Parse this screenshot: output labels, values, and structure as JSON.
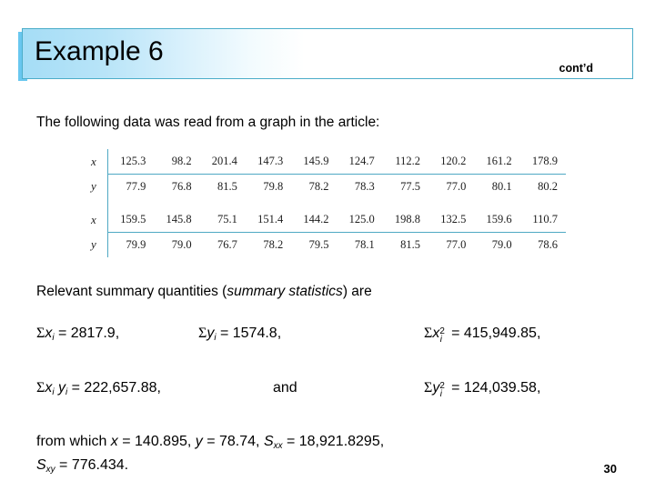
{
  "header": {
    "title": "Example 6",
    "contd_label": "cont’d",
    "accent_color": "#69c7ef",
    "border_color": "#4badc9",
    "gradient_start": "#a5ddf6",
    "gradient_end": "#ffffff"
  },
  "body": {
    "intro_text": "The following data was read from a graph in the article:",
    "summary_prefix": "Relevant summary quantities (",
    "summary_emphasis": "summary statistics",
    "summary_suffix": ") are"
  },
  "table": {
    "rule_color": "#4fa9c4",
    "rows": [
      {
        "label": "x",
        "values": [
          "125.3",
          "98.2",
          "201.4",
          "147.3",
          "145.9",
          "124.7",
          "112.2",
          "120.2",
          "161.2",
          "178.9"
        ]
      },
      {
        "label": "y",
        "values": [
          "77.9",
          "76.8",
          "81.5",
          "79.8",
          "78.2",
          "78.3",
          "77.5",
          "77.0",
          "80.1",
          "80.2"
        ]
      },
      {
        "label": "x",
        "values": [
          "159.5",
          "145.8",
          "75.1",
          "151.4",
          "144.2",
          "125.0",
          "198.8",
          "132.5",
          "159.6",
          "110.7"
        ]
      },
      {
        "label": "y",
        "values": [
          "79.9",
          "79.0",
          "76.7",
          "78.2",
          "79.5",
          "78.1",
          "81.5",
          "77.0",
          "79.0",
          "78.6"
        ]
      }
    ]
  },
  "summary_quantities": {
    "sum_x": {
      "sigma": "Σ",
      "var": "x",
      "sub": "i",
      "equals": "= 2817.9,"
    },
    "sum_y": {
      "sigma": "Σ",
      "var": "y",
      "sub": "i",
      "equals": "= 1574.8,"
    },
    "sum_x2": {
      "sigma": "Σ",
      "var": "x",
      "sup": "2",
      "sub": "i",
      "equals": "= 415,949.85,"
    },
    "sum_xy": {
      "sigma": "Σ",
      "var1": "x",
      "sub1": "i",
      "var2": "y",
      "sub2": "i",
      "equals": "= 222,657.88,"
    },
    "conjunction": "and",
    "sum_y2": {
      "sigma": "Σ",
      "var": "y",
      "sup": "2",
      "sub": "i",
      "equals": "= 124,039.58,"
    }
  },
  "conclusion": {
    "prefix": "from which ",
    "x_var": "x",
    "x_value": " = 140.895, ",
    "y_var": "y",
    "y_value": " = 78.74, ",
    "sxx_var": "S",
    "sxx_sub": "xx",
    "sxx_value": " = 18,921.8295,",
    "sxy_var": "S",
    "sxy_sub": "xy",
    "sxy_value": " = 776.434."
  },
  "page_number": "30"
}
